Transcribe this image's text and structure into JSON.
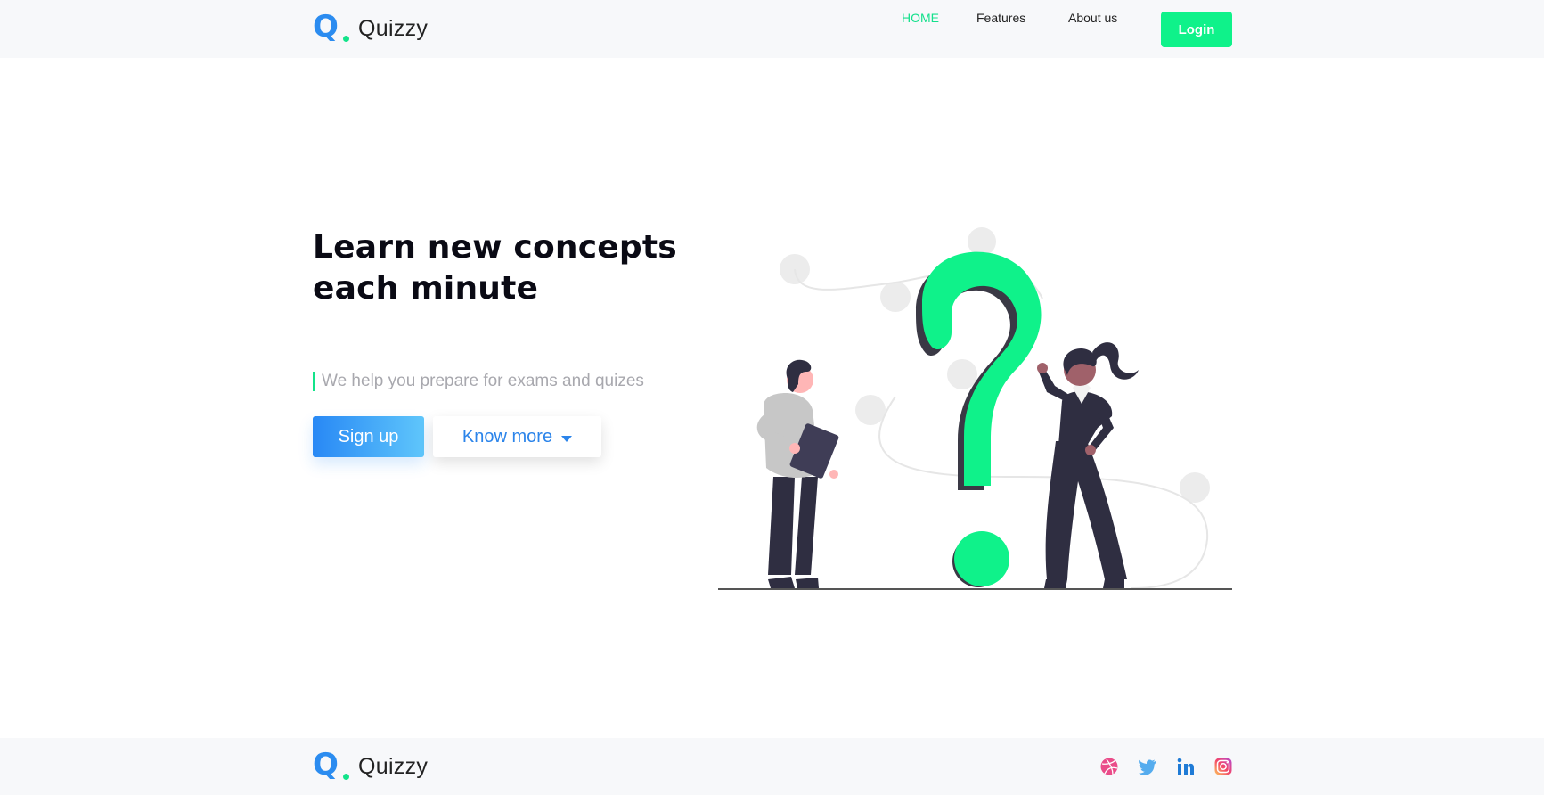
{
  "brand": {
    "name": "Quizzy",
    "mark": "Q"
  },
  "nav": {
    "items": [
      {
        "label": "HOME",
        "active": true
      },
      {
        "label": "Features",
        "active": false
      },
      {
        "label": "About us",
        "active": false
      }
    ],
    "login_label": "Login"
  },
  "hero": {
    "title_line1": "Learn new concepts",
    "title_line2": "each minute",
    "tagline": "We help you prepare for exams and quizes",
    "signup_label": "Sign up",
    "knowmore_label": "Know more"
  },
  "footer": {
    "brand_name": "Quizzy",
    "social_icons": [
      "dribbble-icon",
      "twitter-icon",
      "linkedin-icon",
      "instagram-icon"
    ]
  },
  "colors": {
    "accent_green": "#0ff28a",
    "accent_blue": "#2b84ea",
    "header_bg": "#f7f8fa",
    "figure_dark": "#2f2e41"
  }
}
